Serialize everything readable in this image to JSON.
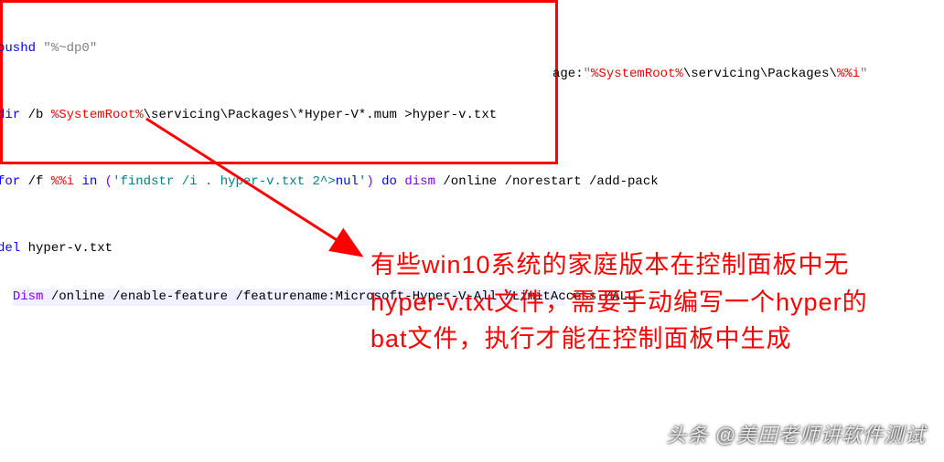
{
  "code": {
    "line1_a": "pushd ",
    "line1_b": "\"%~dp0\"",
    "line2_a": "dir",
    "line2_b": " /b ",
    "line2_c": "%SystemRoot%",
    "line2_d": "\\servicing\\Packages\\*Hyper-V*.mum >hyper-v.txt",
    "line3_a": "for",
    "line3_b": " /f ",
    "line3_c": "%%i",
    "line3_d": " in",
    "line3_e": " (",
    "line3_f": "'findstr /i . hyper-v.txt 2^>",
    "line3_g": "nul",
    "line3_h": "'",
    "line3_i": ") ",
    "line3_j": "do",
    "line3_k": " dism",
    "line3_l": " /online /norestart /add-pack",
    "line3_over_a": "age:",
    "line3_over_b": "\"",
    "line3_over_c": "%SystemRoot%",
    "line3_over_d": "\\servicing\\Packages\\",
    "line3_over_e": "%%i",
    "line3_over_f": "\"",
    "line4_a": "del",
    "line4_b": " hyper-v.txt",
    "line5_a": "Dism",
    "line5_b": " /online /enable-feature /featurename:Microsoft-Hyper-V-All /LimitAccess /ALL"
  },
  "annotation": {
    "text": "有些win10系统的家庭版本在控制面板中无hyper-v.txt文件，需要手动编写一个hyper的bat文件，执行才能在控制面板中生成"
  },
  "watermark": {
    "text": "头条 @美田老师讲软件测试"
  }
}
